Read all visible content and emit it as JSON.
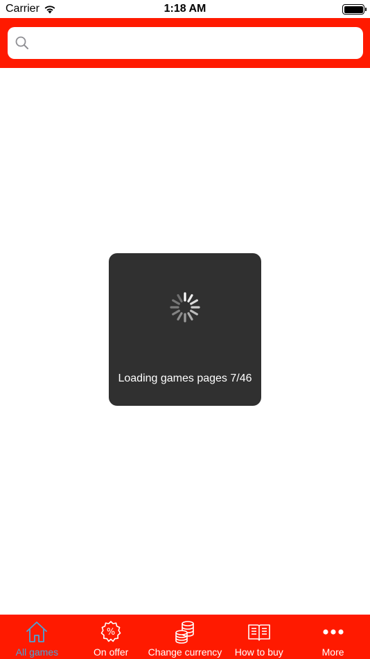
{
  "status_bar": {
    "carrier": "Carrier",
    "time": "1:18 AM"
  },
  "search": {
    "placeholder": "",
    "value": ""
  },
  "loading": {
    "message": "Loading games pages 7/46"
  },
  "tabs": [
    {
      "label": "All games",
      "icon": "house-icon",
      "active": true
    },
    {
      "label": "On offer",
      "icon": "percent-badge-icon",
      "active": false
    },
    {
      "label": "Change currency",
      "icon": "coin-stack-icon",
      "active": false
    },
    {
      "label": "How to buy",
      "icon": "open-book-icon",
      "active": false
    },
    {
      "label": "More",
      "icon": "more-dots-icon",
      "active": false
    }
  ],
  "colors": {
    "brand_red": "#ff1a00",
    "active_tab": "#4aa3d8",
    "hud_background": "#303030"
  }
}
